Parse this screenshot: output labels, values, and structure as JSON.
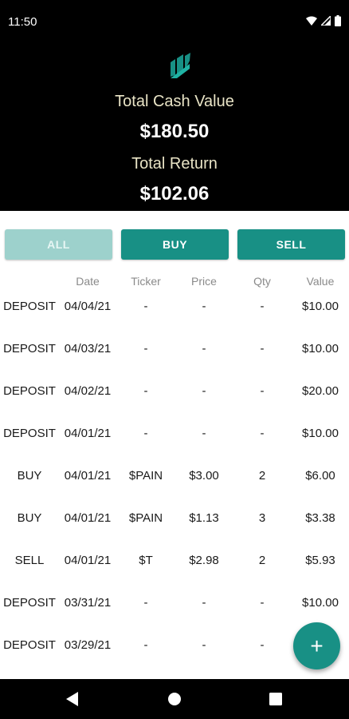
{
  "status": {
    "time": "11:50"
  },
  "summary": {
    "cash_label": "Total Cash Value",
    "cash_value": "$180.50",
    "return_label": "Total Return",
    "return_value": "$102.06"
  },
  "filters": {
    "all": "ALL",
    "buy": "BUY",
    "sell": "SELL"
  },
  "columns": {
    "date": "Date",
    "ticker": "Ticker",
    "price": "Price",
    "qty": "Qty",
    "value": "Value"
  },
  "transactions": [
    {
      "type": "DEPOSIT",
      "date": "04/04/21",
      "ticker": "-",
      "price": "-",
      "qty": "-",
      "value": "$10.00"
    },
    {
      "type": "DEPOSIT",
      "date": "04/03/21",
      "ticker": "-",
      "price": "-",
      "qty": "-",
      "value": "$10.00"
    },
    {
      "type": "DEPOSIT",
      "date": "04/02/21",
      "ticker": "-",
      "price": "-",
      "qty": "-",
      "value": "$20.00"
    },
    {
      "type": "DEPOSIT",
      "date": "04/01/21",
      "ticker": "-",
      "price": "-",
      "qty": "-",
      "value": "$10.00"
    },
    {
      "type": "BUY",
      "date": "04/01/21",
      "ticker": "$PAIN",
      "price": "$3.00",
      "qty": "2",
      "value": "$6.00"
    },
    {
      "type": "BUY",
      "date": "04/01/21",
      "ticker": "$PAIN",
      "price": "$1.13",
      "qty": "3",
      "value": "$3.38"
    },
    {
      "type": "SELL",
      "date": "04/01/21",
      "ticker": "$T",
      "price": "$2.98",
      "qty": "2",
      "value": "$5.93"
    },
    {
      "type": "DEPOSIT",
      "date": "03/31/21",
      "ticker": "-",
      "price": "-",
      "qty": "-",
      "value": "$10.00"
    },
    {
      "type": "DEPOSIT",
      "date": "03/29/21",
      "ticker": "-",
      "price": "-",
      "qty": "-",
      "value": ""
    }
  ],
  "fab": {
    "icon": "plus-icon",
    "label": "+"
  },
  "colors": {
    "accent": "#189085",
    "accent_light": "#9dd1cc",
    "header_bg": "#000000",
    "header_label": "#e9e4c6"
  },
  "nav": {
    "icons": [
      "back-icon",
      "home-icon",
      "recents-icon"
    ]
  }
}
